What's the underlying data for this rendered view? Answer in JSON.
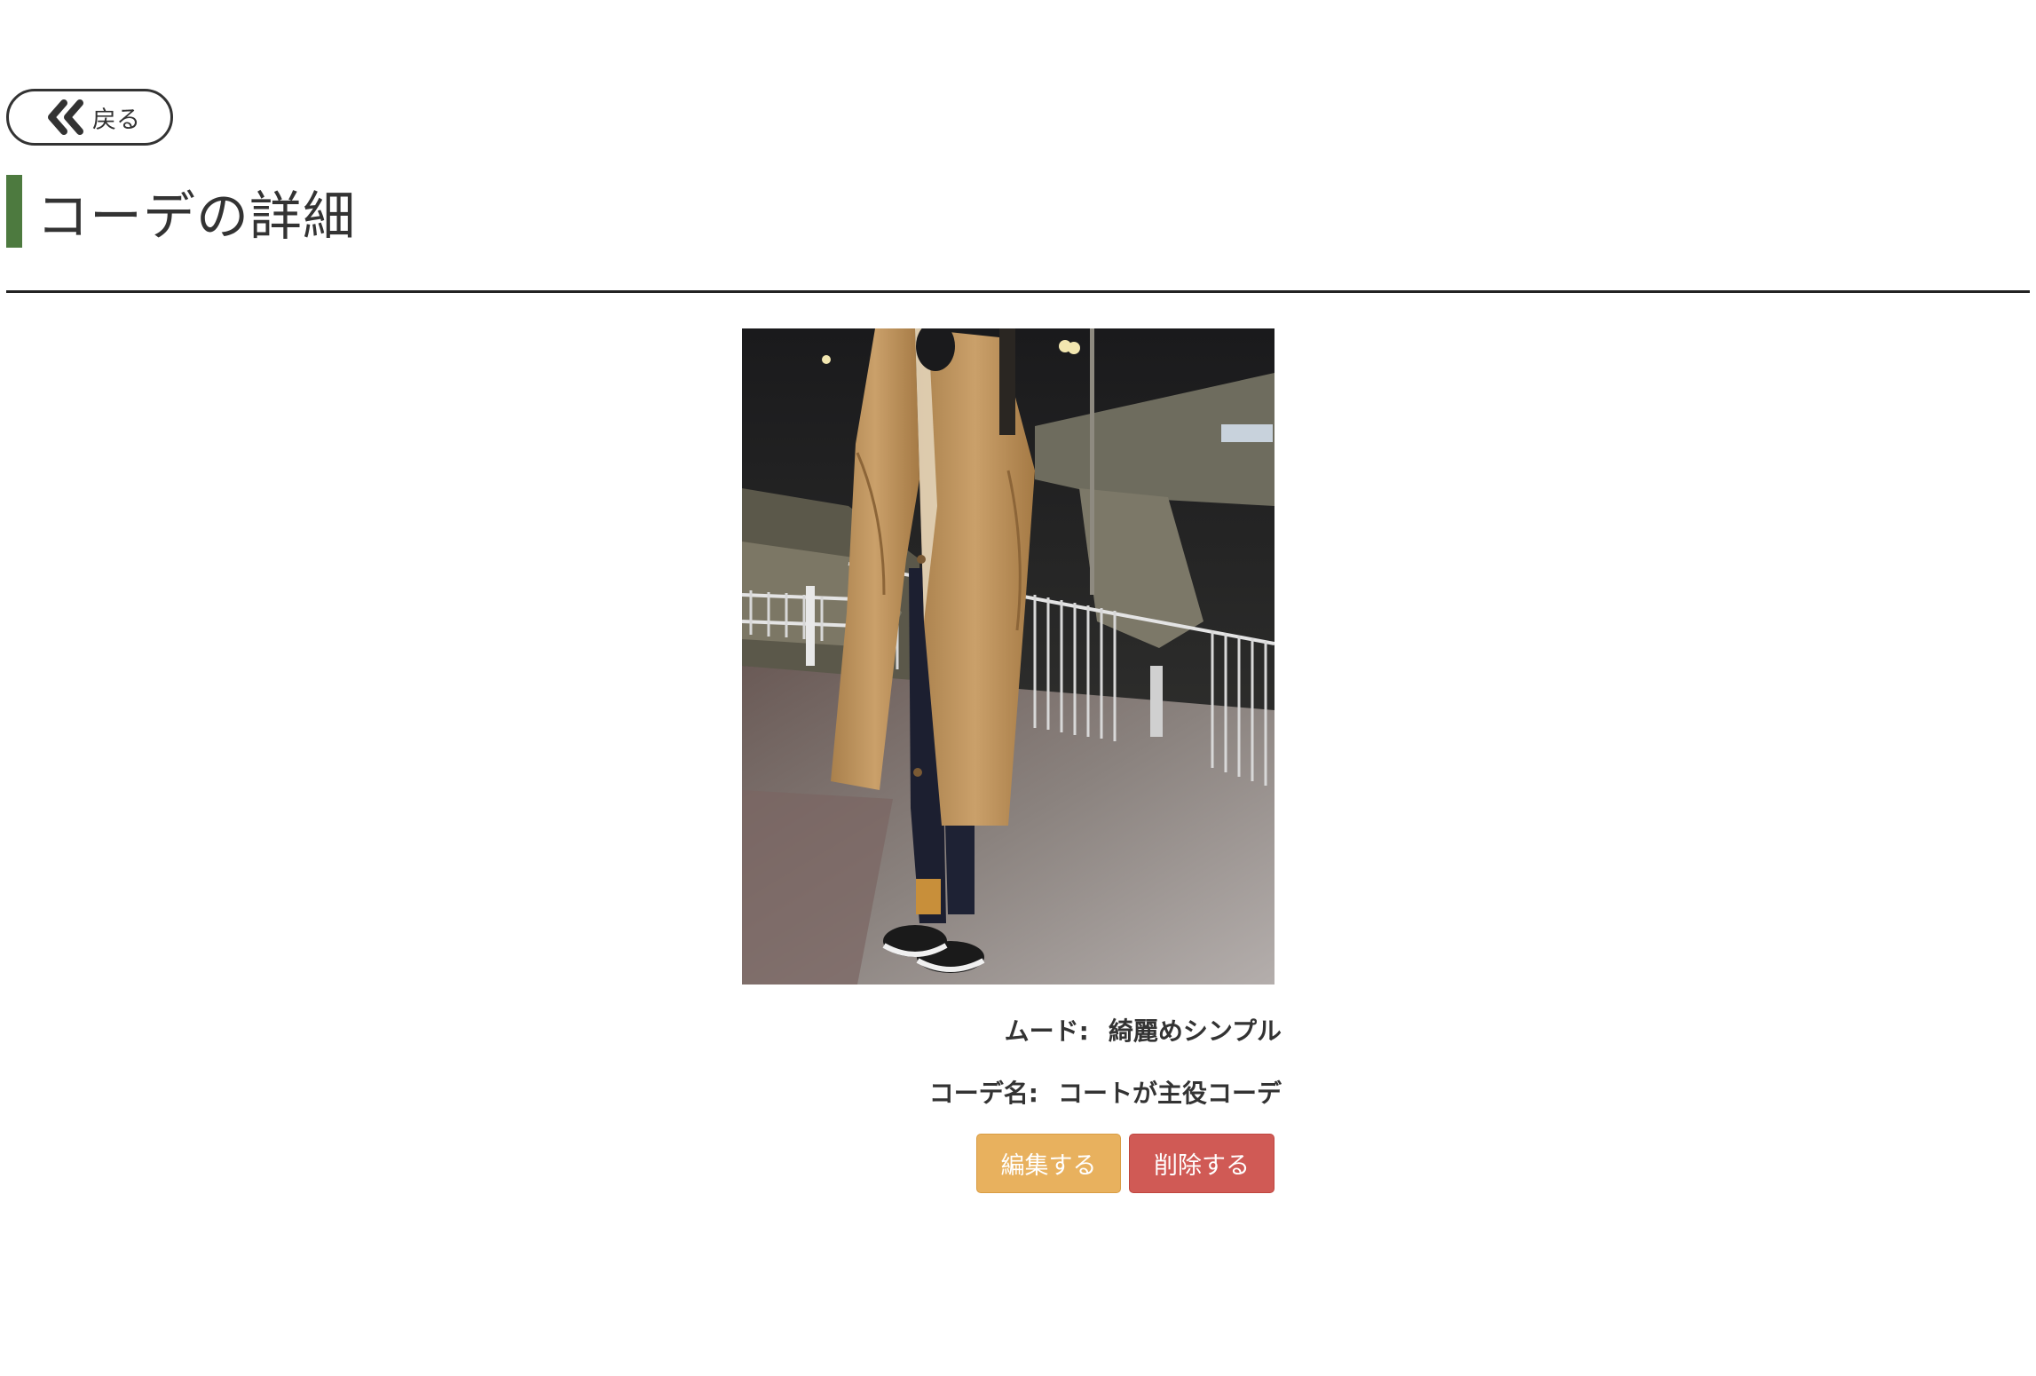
{
  "nav": {
    "back_label": "戻る",
    "back_icon": "double-chevron-left-icon"
  },
  "header": {
    "title": "コーデの詳細",
    "accent_color": "#4d7a3f"
  },
  "detail": {
    "photo_alt": "coat outfit photo",
    "mood_label": "ムード:",
    "mood_value": "綺麗めシンプル",
    "name_label": "コーデ名:",
    "name_value": "コートが主役コーデ"
  },
  "actions": {
    "edit_label": "編集する",
    "delete_label": "削除する",
    "edit_color": "#e8b15e",
    "delete_color": "#d05a55"
  }
}
